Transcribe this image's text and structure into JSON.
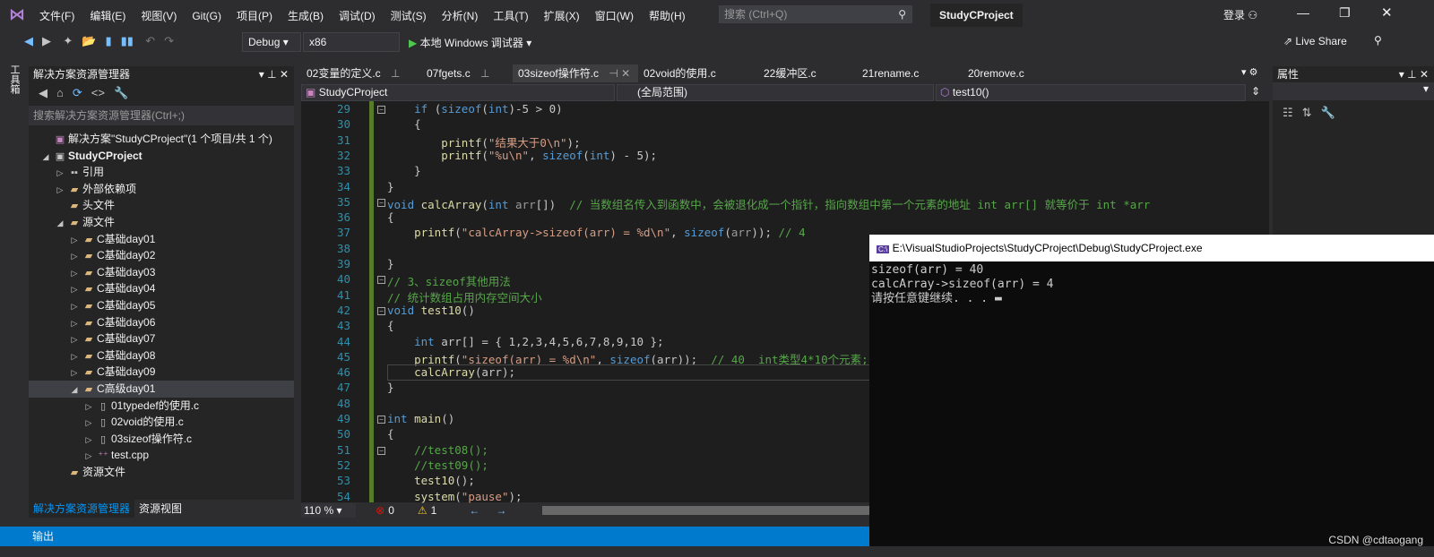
{
  "menu": [
    "文件(F)",
    "编辑(E)",
    "视图(V)",
    "Git(G)",
    "项目(P)",
    "生成(B)",
    "调试(D)",
    "测试(S)",
    "分析(N)",
    "工具(T)",
    "扩展(X)",
    "窗口(W)",
    "帮助(H)"
  ],
  "search_placeholder": "搜索 (Ctrl+Q)",
  "project_title": "StudyCProject",
  "login": "登录",
  "live_share": "Live Share",
  "toolbar": {
    "config": "Debug",
    "platform": "x86",
    "run": "本地 Windows 调试器"
  },
  "toolbox": "工具箱",
  "solution_explorer": {
    "title": "解决方案资源管理器",
    "search": "搜索解决方案资源管理器(Ctrl+;)",
    "items": [
      {
        "label": "解决方案\"StudyCProject\"(1 个项目/共 1 个)",
        "lvl": 0,
        "tri": "",
        "icon": "solution"
      },
      {
        "label": "StudyCProject",
        "lvl": 0,
        "tri": "open",
        "icon": "project",
        "bold": true
      },
      {
        "label": "引用",
        "lvl": 1,
        "tri": "closed",
        "icon": "references"
      },
      {
        "label": "外部依赖项",
        "lvl": 1,
        "tri": "closed",
        "icon": "folder"
      },
      {
        "label": "头文件",
        "lvl": 1,
        "tri": "",
        "icon": "folder"
      },
      {
        "label": "源文件",
        "lvl": 1,
        "tri": "open",
        "icon": "folder"
      },
      {
        "label": "C基础day01",
        "lvl": 2,
        "tri": "closed",
        "icon": "folder"
      },
      {
        "label": "C基础day02",
        "lvl": 2,
        "tri": "closed",
        "icon": "folder"
      },
      {
        "label": "C基础day03",
        "lvl": 2,
        "tri": "closed",
        "icon": "folder"
      },
      {
        "label": "C基础day04",
        "lvl": 2,
        "tri": "closed",
        "icon": "folder"
      },
      {
        "label": "C基础day05",
        "lvl": 2,
        "tri": "closed",
        "icon": "folder"
      },
      {
        "label": "C基础day06",
        "lvl": 2,
        "tri": "closed",
        "icon": "folder"
      },
      {
        "label": "C基础day07",
        "lvl": 2,
        "tri": "closed",
        "icon": "folder"
      },
      {
        "label": "C基础day08",
        "lvl": 2,
        "tri": "closed",
        "icon": "folder"
      },
      {
        "label": "C基础day09",
        "lvl": 2,
        "tri": "closed",
        "icon": "folder"
      },
      {
        "label": "C高级day01",
        "lvl": 2,
        "tri": "open",
        "icon": "folder",
        "selected": true
      },
      {
        "label": "01typedef的使用.c",
        "lvl": 3,
        "tri": "closed",
        "icon": "c-file"
      },
      {
        "label": "02void的使用.c",
        "lvl": 3,
        "tri": "closed",
        "icon": "c-file"
      },
      {
        "label": "03sizeof操作符.c",
        "lvl": 3,
        "tri": "closed",
        "icon": "c-file"
      },
      {
        "label": "test.cpp",
        "lvl": 3,
        "tri": "closed",
        "icon": "cpp-file"
      },
      {
        "label": "资源文件",
        "lvl": 1,
        "tri": "",
        "icon": "folder"
      }
    ],
    "bottom_tabs": [
      "解决方案资源管理器",
      "资源视图"
    ]
  },
  "tabs": [
    {
      "label": "02变量的定义.c",
      "pin": true
    },
    {
      "label": "07fgets.c",
      "pin": true
    },
    {
      "label": "03sizeof操作符.c",
      "active": true
    },
    {
      "label": "02void的使用.c"
    },
    {
      "label": "22缓冲区.c"
    },
    {
      "label": "21rename.c"
    },
    {
      "label": "20remove.c"
    }
  ],
  "navbar": {
    "project": "StudyCProject",
    "scope": "(全局范围)",
    "member": "test10()"
  },
  "code": [
    {
      "n": 29,
      "fold": true,
      "t": [
        [
          "t",
          "    "
        ],
        [
          "k",
          "if"
        ],
        [
          "t",
          " ("
        ],
        [
          "k",
          "sizeof"
        ],
        [
          "t",
          "("
        ],
        [
          "k",
          "int"
        ],
        [
          "t",
          ")-5 > 0)"
        ]
      ]
    },
    {
      "n": 30,
      "t": [
        [
          "t",
          "    {"
        ]
      ]
    },
    {
      "n": 31,
      "t": [
        [
          "t",
          "        "
        ],
        [
          "f",
          "printf"
        ],
        [
          "t",
          "("
        ],
        [
          "s",
          "\"结果大于0\\n\""
        ],
        [
          "t",
          ");"
        ]
      ]
    },
    {
      "n": 32,
      "t": [
        [
          "t",
          "        "
        ],
        [
          "f",
          "printf"
        ],
        [
          "t",
          "("
        ],
        [
          "s",
          "\"%u\\n\""
        ],
        [
          "t",
          ", "
        ],
        [
          "k",
          "sizeof"
        ],
        [
          "t",
          "("
        ],
        [
          "k",
          "int"
        ],
        [
          "t",
          ") - 5);"
        ]
      ]
    },
    {
      "n": 33,
      "t": [
        [
          "t",
          "    }"
        ]
      ]
    },
    {
      "n": 34,
      "t": [
        [
          "t",
          "}"
        ]
      ]
    },
    {
      "n": 35,
      "fold": true,
      "t": [
        [
          "k",
          "void"
        ],
        [
          "t",
          " "
        ],
        [
          "f",
          "calcArray"
        ],
        [
          "t",
          "("
        ],
        [
          "k",
          "int"
        ],
        [
          "t",
          " "
        ],
        [
          "p",
          "arr"
        ],
        [
          "t",
          "[])  "
        ],
        [
          "c",
          "// 当数组名传入到函数中，会被退化成一个指针，指向数组中第一个元素的地址 int arr[] 就等价于 int *arr"
        ]
      ]
    },
    {
      "n": 36,
      "t": [
        [
          "t",
          "{"
        ]
      ]
    },
    {
      "n": 37,
      "t": [
        [
          "t",
          "    "
        ],
        [
          "f",
          "printf"
        ],
        [
          "t",
          "("
        ],
        [
          "s",
          "\"calcArray->sizeof(arr) = %d\\n\""
        ],
        [
          "t",
          ", "
        ],
        [
          "k",
          "sizeof"
        ],
        [
          "t",
          "("
        ],
        [
          "p",
          "arr"
        ],
        [
          "t",
          "));"
        ],
        [
          "c",
          " // 4"
        ]
      ]
    },
    {
      "n": 38,
      "t": []
    },
    {
      "n": 39,
      "t": [
        [
          "t",
          "}"
        ]
      ]
    },
    {
      "n": 40,
      "fold": true,
      "t": [
        [
          "c",
          "// 3、sizeof其他用法"
        ]
      ]
    },
    {
      "n": 41,
      "t": [
        [
          "c",
          "// 统计数组占用内存空间大小"
        ]
      ]
    },
    {
      "n": 42,
      "fold": true,
      "t": [
        [
          "k",
          "void"
        ],
        [
          "t",
          " "
        ],
        [
          "f",
          "test10"
        ],
        [
          "t",
          "()"
        ]
      ]
    },
    {
      "n": 43,
      "t": [
        [
          "t",
          "{"
        ]
      ]
    },
    {
      "n": 44,
      "t": [
        [
          "t",
          "    "
        ],
        [
          "k",
          "int"
        ],
        [
          "t",
          " "
        ],
        [
          "t",
          "arr"
        ],
        [
          "t",
          "[] = { 1,2,3,4,5,6,7,8,9,10 };"
        ]
      ]
    },
    {
      "n": 45,
      "t": [
        [
          "t",
          "    "
        ],
        [
          "f",
          "printf"
        ],
        [
          "t",
          "("
        ],
        [
          "s",
          "\"sizeof(arr) = %d\\n\""
        ],
        [
          "t",
          ", "
        ],
        [
          "k",
          "sizeof"
        ],
        [
          "t",
          "(arr));  "
        ],
        [
          "c",
          "// 40  int类型4*10个元素;"
        ]
      ]
    },
    {
      "n": 46,
      "cur": true,
      "t": [
        [
          "t",
          "    "
        ],
        [
          "f",
          "calcArray"
        ],
        [
          "t",
          "(arr);"
        ]
      ]
    },
    {
      "n": 47,
      "t": [
        [
          "t",
          "}"
        ]
      ]
    },
    {
      "n": 48,
      "t": []
    },
    {
      "n": 49,
      "fold": true,
      "t": [
        [
          "k",
          "int"
        ],
        [
          "t",
          " "
        ],
        [
          "f",
          "main"
        ],
        [
          "t",
          "()"
        ]
      ]
    },
    {
      "n": 50,
      "t": [
        [
          "t",
          "{"
        ]
      ]
    },
    {
      "n": 51,
      "fold": true,
      "t": [
        [
          "t",
          "    "
        ],
        [
          "c",
          "//test08();"
        ]
      ]
    },
    {
      "n": 52,
      "t": [
        [
          "t",
          "    "
        ],
        [
          "c",
          "//test09();"
        ]
      ]
    },
    {
      "n": 53,
      "t": [
        [
          "t",
          "    "
        ],
        [
          "f",
          "test10"
        ],
        [
          "t",
          "();"
        ]
      ]
    },
    {
      "n": 54,
      "t": [
        [
          "t",
          "    "
        ],
        [
          "f",
          "system"
        ],
        [
          "t",
          "("
        ],
        [
          "s",
          "\"pause\""
        ],
        [
          "t",
          ");"
        ]
      ]
    }
  ],
  "editor_status": {
    "zoom": "110 %",
    "errors": "0",
    "warnings": "1"
  },
  "properties": {
    "title": "属性"
  },
  "status_bar": "输出",
  "console": {
    "title": "E:\\VisualStudioProjects\\StudyCProject\\Debug\\StudyCProject.exe",
    "lines": [
      "sizeof(arr) = 40",
      "calcArray->sizeof(arr) = 4",
      "请按任意键继续. . . ▬"
    ]
  },
  "watermark": "CSDN @cdtaogang",
  "colors": {
    "accent": "#007acc",
    "editor_bg": "#1e1e1e",
    "keyword": "#569cd6",
    "comment": "#57a64a",
    "string": "#d69d85"
  }
}
